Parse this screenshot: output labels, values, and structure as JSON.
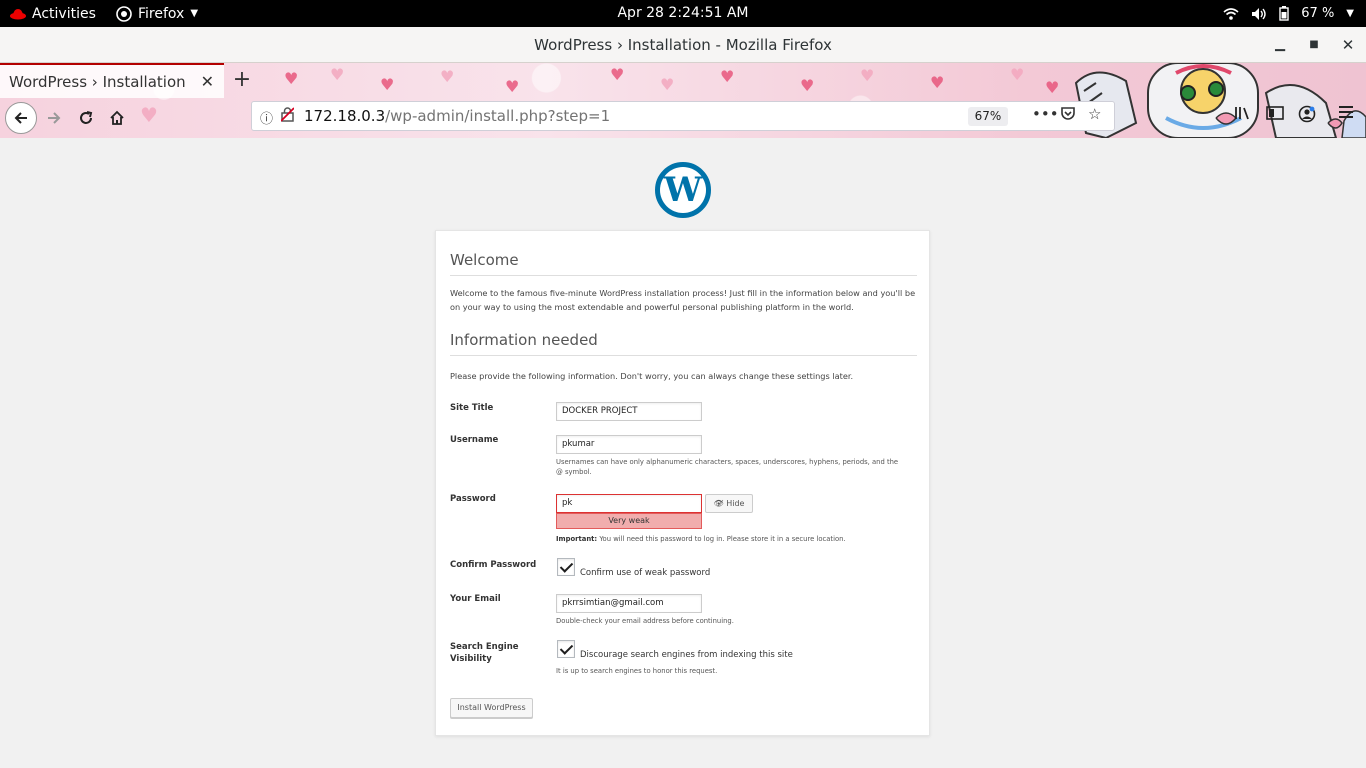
{
  "system_bar": {
    "activities": "Activities",
    "app_menu": "Firefox",
    "clock": "Apr 28   2:24:51 AM",
    "battery": "67 %"
  },
  "window": {
    "title": "WordPress › Installation - Mozilla Firefox"
  },
  "browser": {
    "tab_title": "WordPress › Installation",
    "url_host": "172.18.0.3",
    "url_path": "/wp-admin/install.php?step=1",
    "zoom": "67%"
  },
  "page": {
    "welcome_heading": "Welcome",
    "welcome_text": "Welcome to the famous five-minute WordPress installation process! Just fill in the information below and you'll be on your way to using the most extendable and powerful personal publishing platform in the world.",
    "info_heading": "Information needed",
    "info_text": "Please provide the following information. Don't worry, you can always change these settings later.",
    "site_title_label": "Site Title",
    "site_title_value": "DOCKER PROJECT",
    "username_label": "Username",
    "username_value": "pkumar",
    "username_hint": "Usernames can have only alphanumeric characters, spaces, underscores, hyphens, periods, and the @ symbol.",
    "password_label": "Password",
    "password_value": "pk",
    "password_hide": "Hide",
    "password_strength": "Very weak",
    "password_important": "Important:",
    "password_hint": "You will need this password to log in. Please store it in a secure location.",
    "confirm_label": "Confirm Password",
    "confirm_checkbox_label": "Confirm use of weak password",
    "email_label": "Your Email",
    "email_value": "pkrrsimtian@gmail.com",
    "email_hint": "Double-check your email address before continuing.",
    "se_label_line1": "Search Engine",
    "se_label_line2": "Visibility",
    "se_checkbox_label": "Discourage search engines from indexing this site",
    "se_hint": "It is up to search engines to honor this request.",
    "install_button": "Install WordPress"
  }
}
